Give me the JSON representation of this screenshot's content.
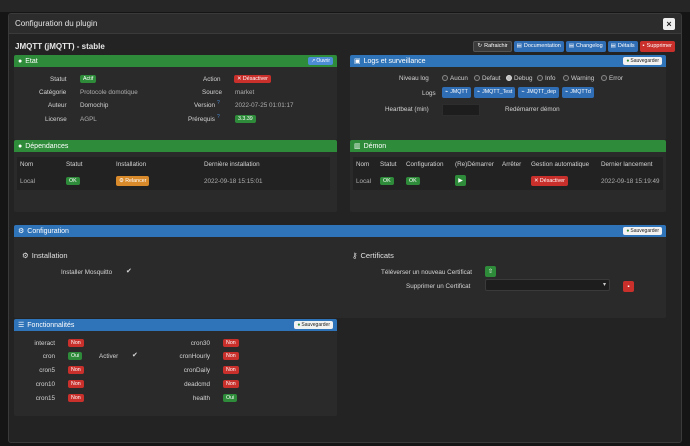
{
  "modal": {
    "title": "Configuration du plugin",
    "close": "×"
  },
  "plugin": {
    "name": "JMQTT (jMQTT) - stable"
  },
  "toolbar": {
    "refresh": "Rafraichir",
    "documentation": "Documentation",
    "changelog": "Changelog",
    "details": "Détails",
    "remove": "Supprimer"
  },
  "etat": {
    "title": "Etat",
    "open": "Ouvrir",
    "statut_label": "Statut",
    "statut_value": "Actif",
    "categorie_label": "Catégorie",
    "categorie_value": "Protocole domotique",
    "auteur_label": "Auteur",
    "auteur_value": "Domochip",
    "license_label": "License",
    "license_value": "AGPL",
    "action_label": "Action",
    "action_value": "Désactiver",
    "source_label": "Source",
    "source_value": "market",
    "version_label": "Version",
    "version_value": "2022-07-25 01:01:17",
    "prereq_label": "Prérequis",
    "prereq_value": "3.3.39"
  },
  "logs": {
    "title": "Logs et surveillance",
    "save": "Sauvegarder",
    "niveau_label": "Niveau log",
    "levels": [
      "Aucun",
      "Defaut",
      "Debug",
      "Info",
      "Warning",
      "Error"
    ],
    "selected_level": "Debug",
    "logs_label": "Logs",
    "log_files": [
      "JMQTT",
      "JMQTT_Test",
      "JMQTT_dep",
      "JMQTTd"
    ],
    "heartbeat_label": "Heartbeat (min)",
    "restart_label": "Redémarrer démon"
  },
  "deps": {
    "title": "Dépendances",
    "headers": [
      "Nom",
      "Statut",
      "Installation",
      "Dernière installation"
    ],
    "row": {
      "nom": "Local",
      "statut": "OK",
      "installation": "Relancer",
      "last": "2022-09-18 15:15:01"
    }
  },
  "demon": {
    "title": "Démon",
    "headers": [
      "Nom",
      "Statut",
      "Configuration",
      "(Re)Démarrer",
      "Arrêter",
      "Gestion automatique",
      "Dernier lancement"
    ],
    "row": {
      "nom": "Local",
      "statut": "OK",
      "configuration": "OK",
      "gestion": "Désactiver",
      "last": "2022-09-18 15:19:49"
    }
  },
  "config": {
    "title": "Configuration",
    "save": "Sauvegarder",
    "installation_title": "Installation",
    "install_mosquitto_label": "Installer Mosquitto",
    "certificats_title": "Certificats",
    "upload_label": "Téléverser un nouveau Certificat",
    "delete_label": "Supprimer un Certificat"
  },
  "fonct": {
    "title": "Fonctionnalités",
    "save": "Sauvegarder",
    "left": [
      {
        "name": "interact",
        "value": "Non"
      },
      {
        "name": "cron",
        "value": "Oui"
      },
      {
        "name": "cron5",
        "value": "Non"
      },
      {
        "name": "cron10",
        "value": "Non"
      },
      {
        "name": "cron15",
        "value": "Non"
      }
    ],
    "activer_label": "Activer",
    "right": [
      {
        "name": "cron30",
        "value": "Non"
      },
      {
        "name": "cronHourly",
        "value": "Non"
      },
      {
        "name": "cronDaily",
        "value": "Non"
      },
      {
        "name": "deadcmd",
        "value": "Non"
      },
      {
        "name": "health",
        "value": "Oui"
      }
    ]
  },
  "colors": {
    "green": "#2e8b3a",
    "blue": "#2f73b8",
    "red": "#c9302c",
    "orange": "#d98a2b"
  }
}
